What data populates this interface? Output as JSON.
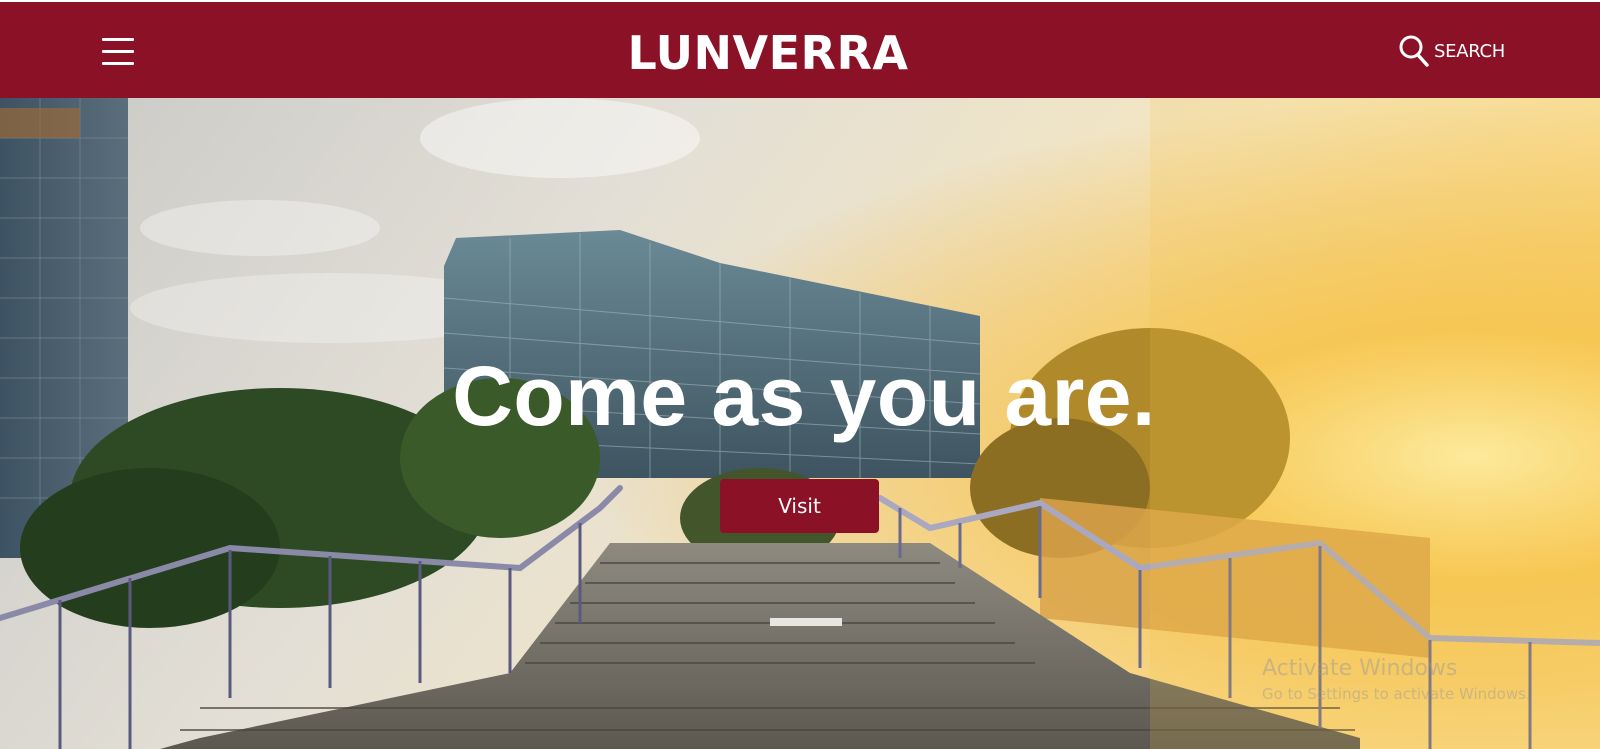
{
  "header": {
    "logo": "LUNVERRA",
    "search_label": "SEARCH",
    "menu_icon": "hamburger-menu-icon",
    "search_icon": "magnifier-icon"
  },
  "hero": {
    "tagline": "Come as you are.",
    "cta_label": "Visit",
    "image_description": ""
  },
  "watermark": {
    "line1": "Activate Windows",
    "line2": "Go to Settings to activate Windows."
  },
  "colors": {
    "brand": "#8a1126",
    "text_on_brand": "#ffffff"
  }
}
